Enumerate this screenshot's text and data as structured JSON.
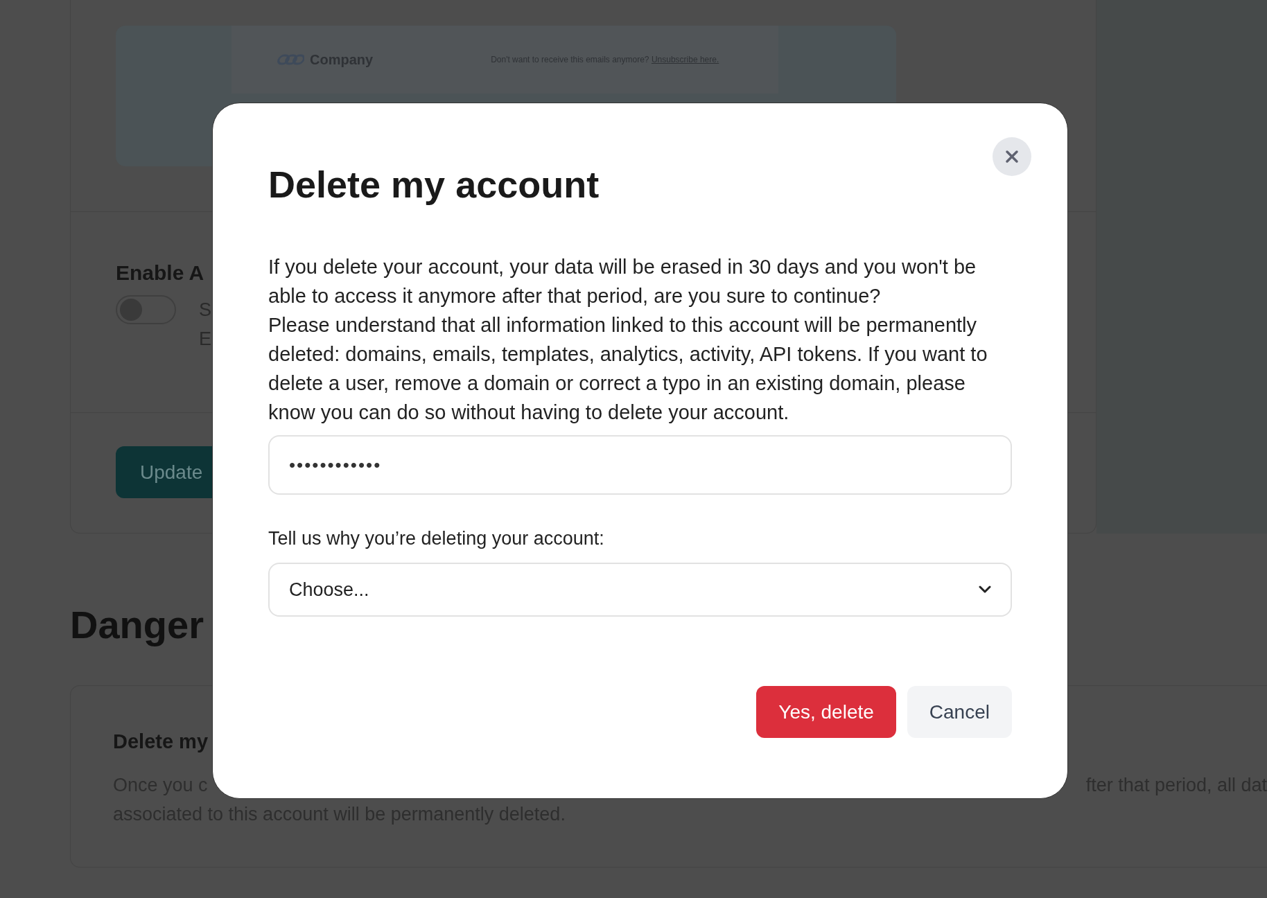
{
  "background": {
    "email_preview": {
      "logo_text": "Company",
      "footer_text": "Don't want to receive this emails anymore?",
      "footer_link": "Unsubscribe here."
    },
    "ai_section": {
      "title": "Enable A",
      "toggle_on": false,
      "description_lines": [
        "S",
        "E"
      ]
    },
    "update_button": "Update",
    "danger_title": "Danger",
    "delete_card": {
      "title": "Delete my",
      "description_start": "Once you c",
      "description_end": "fter that period, all dat",
      "description_line_2": "associated to this account will be permanently deleted."
    }
  },
  "dialog": {
    "title": "Delete my account",
    "paragraphs": [
      "If you delete your account, your data will be erased in 30 days and you won't be able to access it anymore after that period, are you sure to continue?",
      "Please understand that all information linked to this account will be permanently deleted: domains, emails, templates, analytics, activity, API tokens. If you want to delete a user, remove a domain or correct a typo in an existing domain, please know you can do so without having to delete your account."
    ],
    "password_field": {
      "value": "••••••••••••"
    },
    "reason_label": "Tell us why you’re deleting your account:",
    "reason_select": {
      "value": "Choose..."
    },
    "buttons": [
      {
        "label": "Yes, delete",
        "kind": "danger"
      },
      {
        "label": "Cancel",
        "kind": "secondary"
      }
    ]
  }
}
